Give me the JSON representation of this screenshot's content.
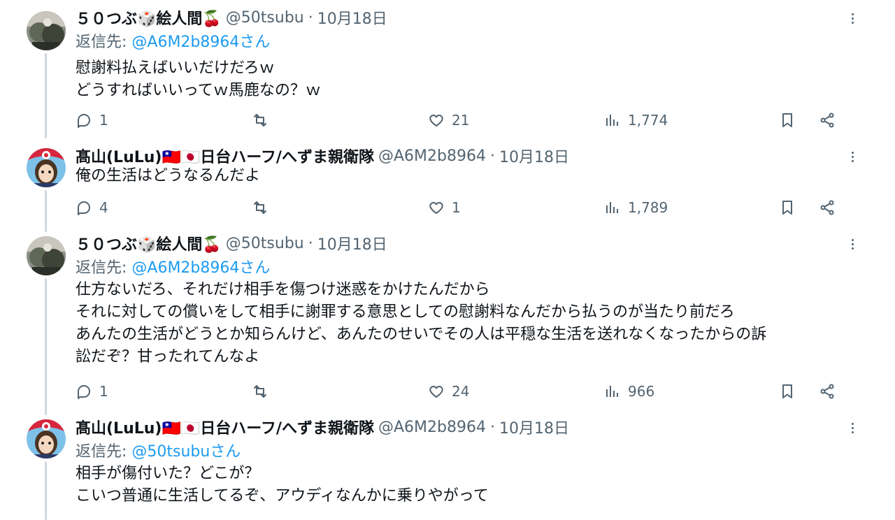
{
  "colors": {
    "text": "#0f1419",
    "secondary": "#536471",
    "link": "#1d9bf0",
    "thread": "#cfd9de"
  },
  "tweets": [
    {
      "display_name": "５０つぶ🎲絵人間🍒",
      "handle": "@50tsubu",
      "dot": "·",
      "date": "10月18日",
      "reply_prefix": "返信先: ",
      "reply_link": "@A6M2b8964さん",
      "lines": [
        "慰謝料払えばいいだけだろｗ",
        "どうすればいいってｗ馬鹿なの？ｗ"
      ],
      "replies": "1",
      "retweets": "",
      "likes": "21",
      "views": "1,774"
    },
    {
      "display_name": "髙山(LuLu)🇹🇼🇯🇵日台ハーフ/へずま親衛隊",
      "handle": "@A6M2b8964",
      "dot": "·",
      "date": "10月18日",
      "lines": [
        "俺の生活はどうなるんだよ"
      ],
      "replies": "4",
      "retweets": "",
      "likes": "1",
      "views": "1,789"
    },
    {
      "display_name": "５０つぶ🎲絵人間🍒",
      "handle": "@50tsubu",
      "dot": "·",
      "date": "10月18日",
      "reply_prefix": "返信先: ",
      "reply_link": "@A6M2b8964さん",
      "lines": [
        "仕方ないだろ、それだけ相手を傷つけ迷惑をかけたんだから",
        "それに対しての償いをして相手に謝罪する意思としての慰謝料なんだから払うのが当たり前だろ",
        "あんたの生活がどうとか知らんけど、あんたのせいでその人は平穏な生活を送れなくなったからの訴",
        "訟だぞ？甘ったれてんなよ"
      ],
      "replies": "1",
      "retweets": "",
      "likes": "24",
      "views": "966"
    },
    {
      "display_name": "髙山(LuLu)🇹🇼🇯🇵日台ハーフ/へずま親衛隊",
      "handle": "@A6M2b8964",
      "dot": "·",
      "date": "10月18日",
      "reply_prefix": "返信先: ",
      "reply_link": "@50tsubuさん",
      "lines": [
        "相手が傷付いた？どこが？",
        "こいつ普通に生活してるぞ、アウディなんかに乗りやがって"
      ]
    }
  ]
}
